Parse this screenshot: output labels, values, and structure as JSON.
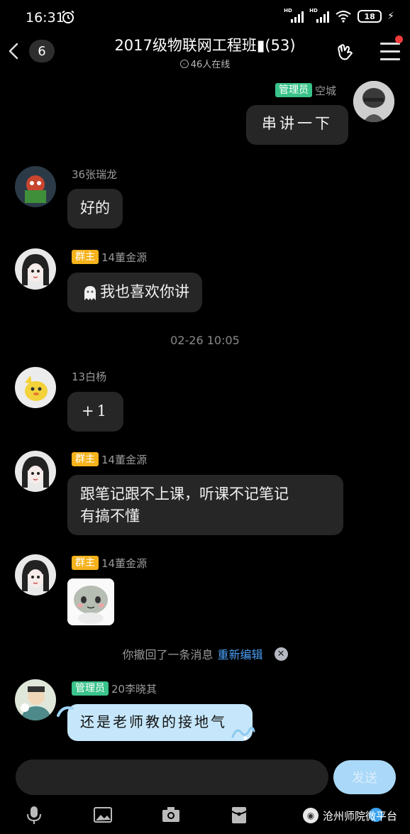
{
  "status_bar": {
    "time": "16:31",
    "signal_labels": [
      "HD",
      "HD"
    ],
    "battery": "18",
    "alarm_icon": "alarm-clock-icon",
    "wifi_icon": "wifi-icon"
  },
  "header": {
    "unread_count": "6",
    "title": "2017级物联网工程班▮(53)",
    "online_text": "46人在线",
    "notification_dot_color": "#f23c3c"
  },
  "messages": [
    {
      "sender": "空城",
      "role": "管理员",
      "text": "串讲一下",
      "outgoing": true
    },
    {
      "sender": "36张瑞龙",
      "text": "好的"
    },
    {
      "sender": "14董金源",
      "role": "群主",
      "text": "我也喜欢你讲"
    },
    {
      "sender": "13白杨",
      "text": "+1"
    },
    {
      "sender": "14董金源",
      "role": "群主",
      "text_line1": "跟笔记跟不上课，听课不记笔记",
      "text_line2": "有搞不懂"
    },
    {
      "sender": "14董金源",
      "role": "群主",
      "sticker": "sticker-image"
    },
    {
      "sender": "20李晓其",
      "role": "管理员",
      "text": "还是老师教的接地气"
    }
  ],
  "timestamp": "02-26 10:05",
  "recall_notice": {
    "text": "你撤回了一条消息",
    "link": "重新编辑"
  },
  "composer": {
    "send_label": "发送",
    "send_color": "#a9d8f8"
  },
  "watermark": "沧州师院微平台",
  "colors": {
    "admin_badge": "#3ac38a",
    "owner_badge": "#f5b21b",
    "link": "#4a9ff5",
    "bubble": "#262626"
  }
}
